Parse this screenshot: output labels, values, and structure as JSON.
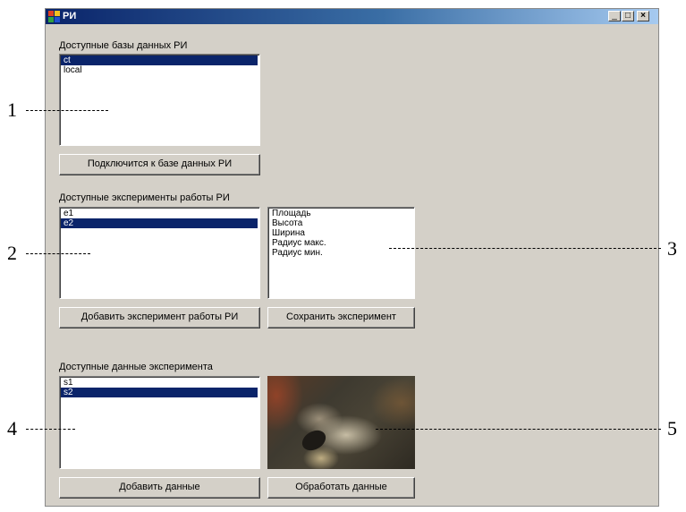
{
  "window": {
    "title": "РИ",
    "controls": {
      "minimize": "_",
      "maximize": "□",
      "close": "×"
    }
  },
  "databases": {
    "label": "Доступные базы данных РИ",
    "items": [
      {
        "text": "ct",
        "selected": true
      },
      {
        "text": "local",
        "selected": false
      }
    ],
    "connect_button": "Подключится к базе данных РИ"
  },
  "experiments": {
    "label": "Доступные эксперименты работы РИ",
    "items": [
      {
        "text": "e1",
        "selected": false
      },
      {
        "text": "e2",
        "selected": true
      }
    ],
    "params": [
      "Площадь",
      "Высота",
      "Ширина",
      "Радиус макс.",
      "Радиус мин."
    ],
    "add_button": "Добавить эксперимент работы РИ",
    "save_button": "Сохранить эксперимент"
  },
  "experiment_data": {
    "label": "Доступные данные эксперимента",
    "items": [
      {
        "text": "s1",
        "selected": false
      },
      {
        "text": "s2",
        "selected": true
      }
    ],
    "add_button": "Добавить данные",
    "process_button": "Обработать данные"
  },
  "callouts": [
    "1",
    "2",
    "3",
    "4",
    "5"
  ],
  "colors": {
    "window_bg": "#d4d0c8",
    "selection": "#0a246a",
    "title_start": "#0a246a",
    "title_end": "#a6caf0"
  }
}
